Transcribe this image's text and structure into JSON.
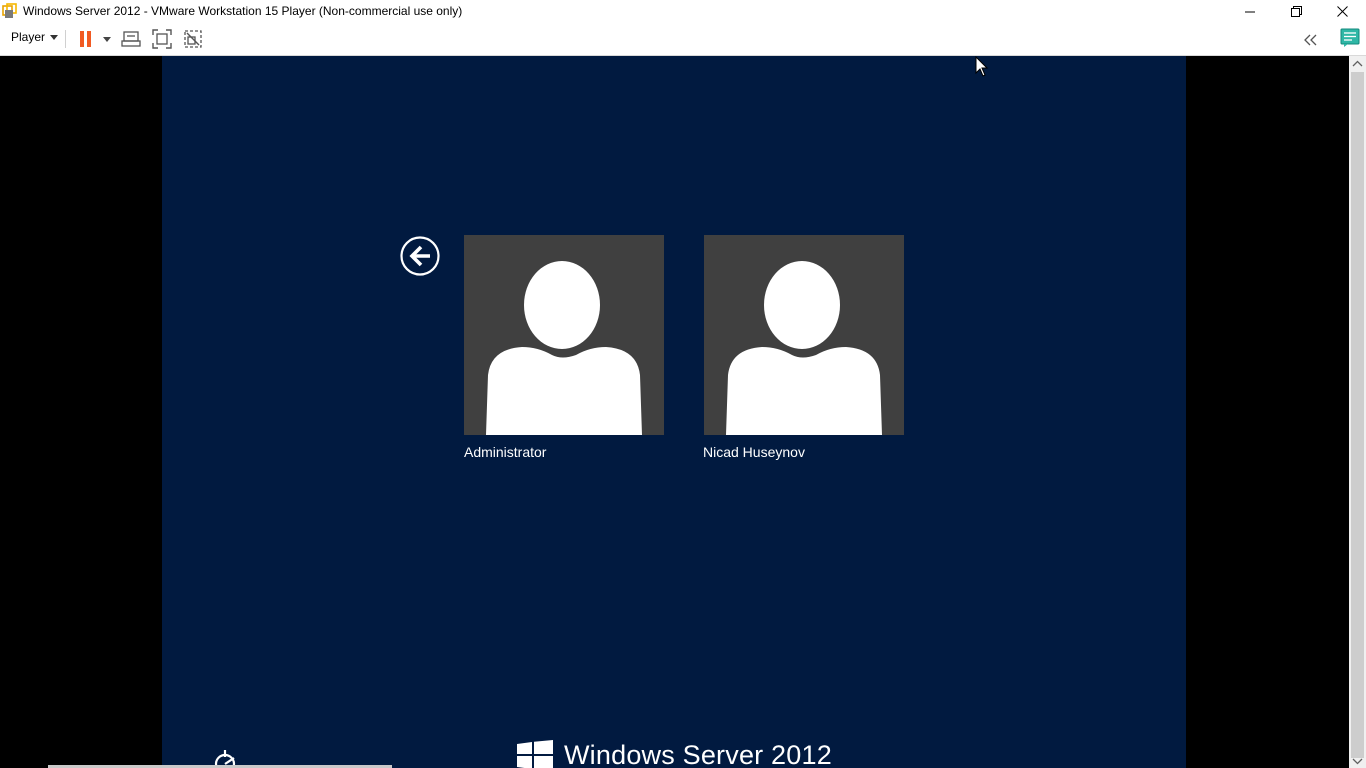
{
  "window": {
    "title": "Windows Server 2012 - VMware Workstation 15 Player (Non-commercial use only)",
    "controls": [
      "minimize-icon",
      "restore-icon",
      "close-icon"
    ]
  },
  "toolbar": {
    "player_menu_label": "Player",
    "icons": [
      "pause-icon",
      "dropdown-arrow-icon",
      "send-ctrl-alt-del-icon",
      "full-screen-icon",
      "unity-icon",
      "collapse-toolbar-icon",
      "message-log-icon"
    ],
    "accent_color": "#f15a22"
  },
  "guest": {
    "background_color": "#011a40",
    "users": [
      {
        "name": "Administrator"
      },
      {
        "name": "Nicad Huseynov"
      }
    ],
    "back_icon": "back-arrow-icon",
    "ease_of_access_icon": "ease-of-access-icon",
    "brand_logo_icon": "windows-logo-icon",
    "brand_text": "Windows Server 2012"
  }
}
